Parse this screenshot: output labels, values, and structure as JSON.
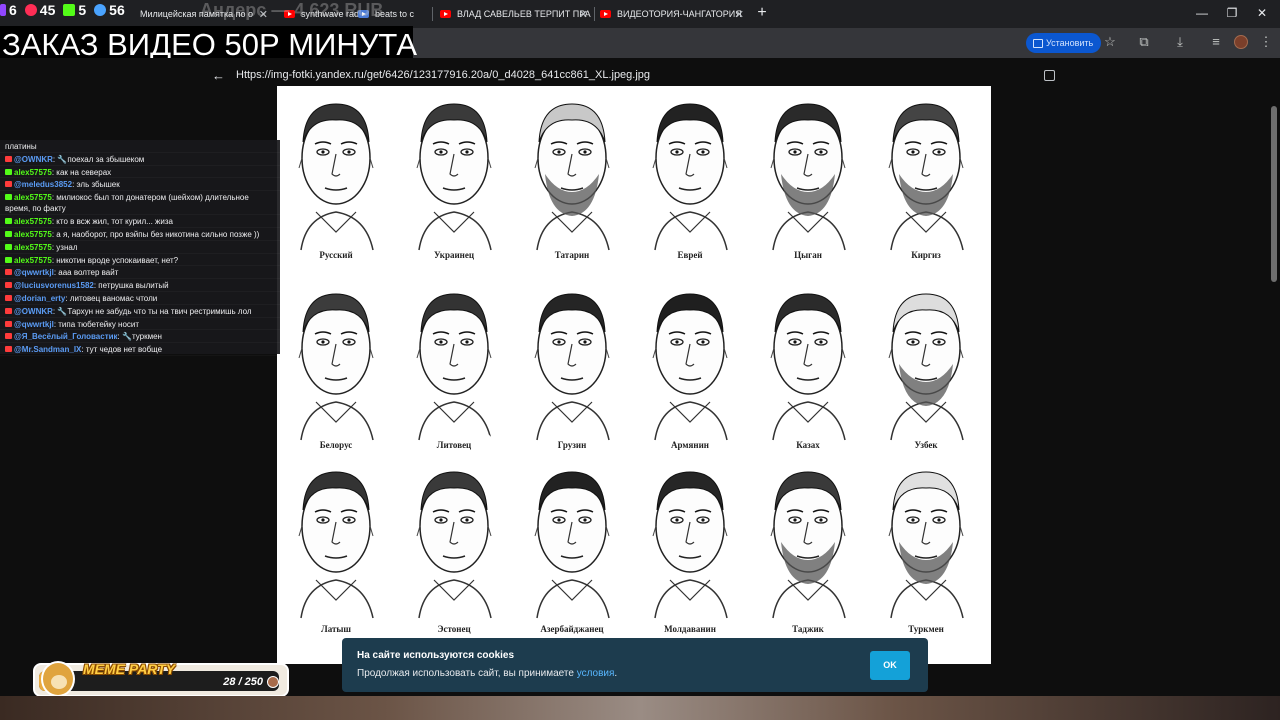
{
  "stats": [
    {
      "icon": "twitch-icon",
      "value": "6",
      "color": "#9146ff"
    },
    {
      "icon": "youtube-icon",
      "value": "45",
      "color": "#ff2d55"
    },
    {
      "icon": "kick-icon",
      "value": "5",
      "color": "#53fc18"
    },
    {
      "icon": "viewers-icon",
      "value": "56",
      "color": "#4aa3ff"
    }
  ],
  "ghost_overlay": "Андерс — 4 623 RUB",
  "tabs": [
    {
      "label": "Милицейская памятка по о"
    },
    {
      "label": "synthwave radio"
    },
    {
      "label": "beats to c"
    },
    {
      "label": "ВЛАД САВЕЛЬЕВ ТЕРПИТ ПРА"
    },
    {
      "label": "ВИДЕОТОРИЯ-ЧАНГАТОРИЯ"
    }
  ],
  "window_controls": {
    "minimize": "—",
    "restore": "❐",
    "close": "✕",
    "new_tab": "+"
  },
  "order_banner": "ЗАКАЗ ВИДЕО 50Р МИНУТА",
  "toolbar": {
    "install_label": "Установить"
  },
  "viewer": {
    "url": "Https://img-fotki.yandex.ru/get/6426/123177916.20a/0_d4028_641cc861_XL.jpeg.jpg"
  },
  "faces": [
    {
      "label": "Русский"
    },
    {
      "label": "Украинец"
    },
    {
      "label": "Татарин"
    },
    {
      "label": "Еврей"
    },
    {
      "label": "Цыган"
    },
    {
      "label": "Киргиз"
    },
    {
      "label": "Белорус"
    },
    {
      "label": "Литовец"
    },
    {
      "label": "Грузин"
    },
    {
      "label": "Армянин"
    },
    {
      "label": "Казах"
    },
    {
      "label": "Узбек"
    },
    {
      "label": "Латыш"
    },
    {
      "label": "Эстонец"
    },
    {
      "label": "Азербайджанец"
    },
    {
      "label": "Молдаванин"
    },
    {
      "label": "Таджик"
    },
    {
      "label": "Туркмен"
    }
  ],
  "chat": {
    "header": "платины",
    "messages": [
      {
        "platform": "yt",
        "user": "@OWNKR",
        "text": "🔧поехал за збышеком"
      },
      {
        "platform": "kick",
        "user": "alex57575",
        "text": "как на северах"
      },
      {
        "platform": "yt",
        "user": "@meledus3852",
        "text": "эль збышек"
      },
      {
        "platform": "kick",
        "user": "alex57575",
        "text": "милиокос был топ донатером (шейхом) длительное время, по факту"
      },
      {
        "platform": "kick",
        "user": "alex57575",
        "text": "кто в всж жил, тот курил... жиза"
      },
      {
        "platform": "kick",
        "user": "alex57575",
        "text": "а я, наоборот, про вэйпы без никотина сильно позже ))"
      },
      {
        "platform": "kick",
        "user": "alex57575",
        "text": "узнал"
      },
      {
        "platform": "kick",
        "user": "alex57575",
        "text": "никотин вроде успокаивает, нет?"
      },
      {
        "platform": "yt",
        "user": "@qwwrtkjl",
        "text": "ааа волтер вайт"
      },
      {
        "platform": "yt",
        "user": "@luciusvorenus1582",
        "text": "петрушка вылитый"
      },
      {
        "platform": "yt",
        "user": "@dorian_erty",
        "text": "литовец ваномас чтоли"
      },
      {
        "platform": "yt",
        "user": "@OWNKR",
        "text": "🔧Тархун не забудь что ты на твич рестримишь лол"
      },
      {
        "platform": "yt",
        "user": "@qwwrtkjl",
        "text": "типа тюбетейку носит"
      },
      {
        "platform": "yt",
        "user": "@Я_Весёлый_Головастик",
        "text": "🔧туркмен"
      },
      {
        "platform": "yt",
        "user": "@Mr.Sandman_IX",
        "text": "тут чедов нет вобще"
      }
    ]
  },
  "meme_party": {
    "title": "MEME PARTY",
    "count": "28 / 250",
    "progress": 0.112
  },
  "cookie": {
    "title": "На сайте используются cookies",
    "text_before": "Продолжая использовать сайт, вы принимаете ",
    "link": "условия",
    "text_after": ".",
    "ok_label": "OK"
  }
}
